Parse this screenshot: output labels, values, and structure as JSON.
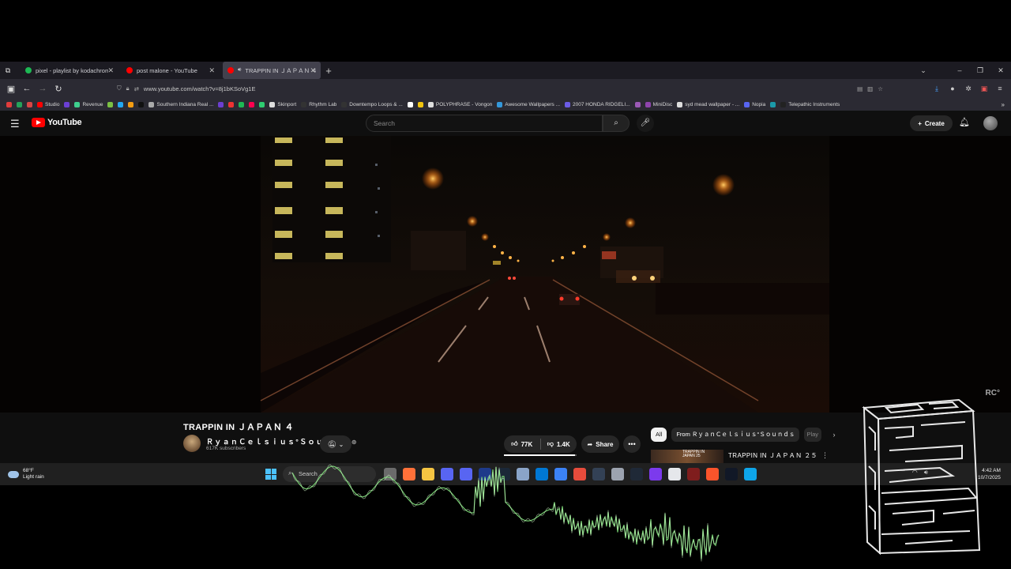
{
  "browser": {
    "tabs": [
      {
        "label": "pixel - playlist by kodachrome",
        "favicon_color": "#1db954",
        "active": false
      },
      {
        "label": "post malone - YouTube",
        "favicon_color": "#ff0000",
        "active": false
      },
      {
        "label": "TRAPPIN IN ＪＡＰＡＮ ４",
        "favicon_color": "#ff0000",
        "active": true
      }
    ],
    "new_tab_glyph": "+",
    "url": "www.youtube.com/watch?v=8j1bKSoVg1E",
    "bookmarks": [
      {
        "label": "",
        "color": "#e03c3c"
      },
      {
        "label": "",
        "color": "#25a35a"
      },
      {
        "label": "",
        "color": "#d94545"
      },
      {
        "label": "Studio",
        "color": "#ff0000"
      },
      {
        "label": "",
        "color": "#6b3fd4"
      },
      {
        "label": "Revenue",
        "color": "#3ecf8e"
      },
      {
        "label": "",
        "color": "#7bc043"
      },
      {
        "label": "",
        "color": "#22a7f0"
      },
      {
        "label": "",
        "color": "#f39c12"
      },
      {
        "label": "",
        "color": "#111"
      },
      {
        "label": "Southern Indiana Real ...",
        "color": "#aaaaaa"
      },
      {
        "label": "",
        "color": "#6c3fd0"
      },
      {
        "label": "",
        "color": "#e33"
      },
      {
        "label": "",
        "color": "#1db954"
      },
      {
        "label": "",
        "color": "#ff0050"
      },
      {
        "label": "",
        "color": "#2ecc71"
      },
      {
        "label": "Skinport",
        "color": "#dddddd"
      },
      {
        "label": "Rhythm Lab",
        "color": "#333"
      },
      {
        "label": "Downtempo Loops & ...",
        "color": "#333"
      },
      {
        "label": "",
        "color": "#ffffff"
      },
      {
        "label": "",
        "color": "#f1c40f"
      },
      {
        "label": "POLYPHRASE - Vongon",
        "color": "#dddddd"
      },
      {
        "label": "Awesome Wallpapers ...",
        "color": "#3498db"
      },
      {
        "label": "2007 HONDA RIDGELI...",
        "color": "#6c5ce7"
      },
      {
        "label": "",
        "color": "#9b59b6"
      },
      {
        "label": "MiniDisc",
        "color": "#8e44ad"
      },
      {
        "label": "syd mead wallpaper - ...",
        "color": "#dddddd"
      },
      {
        "label": "Nopia",
        "color": "#5865f2"
      },
      {
        "label": "",
        "color": "#1b9aaa"
      },
      {
        "label": "Telepathic Instruments",
        "color": "#222"
      }
    ]
  },
  "youtube": {
    "logo_text": "YouTube",
    "search_placeholder": "Search",
    "create_label": "Create",
    "video_title": "TRAPPIN IN ＪＡＰＡＮ ４",
    "channel_name": "ＲｙａｎＣｅｌｓｉｕｓ°Ｓｏｕｎｄｓ",
    "subscribers": "617K subscribers",
    "likes": "77K",
    "dislikes": "1.4K",
    "like_ratio": 0.98,
    "share_label": "Share",
    "chips": [
      "All",
      "From ＲｙａｎＣｅｌｓｉｕｓ°Ｓｏｕｎｄｓ",
      "Play"
    ],
    "rec_title": "TRAPPIN IN ＪＡＰＡＮ ２５",
    "rec_thumb_text": "TRAPPIN IN\nJAPAN 25",
    "watermark": "RC°",
    "accent": "#ff0000"
  },
  "taskbar": {
    "temp": "68°F",
    "weather": "Light rain",
    "search_placeholder": "Search",
    "time": "4:42 AM",
    "date": "10/7/2025",
    "apps": [
      "#6b6b6b",
      "#ff7139",
      "#f5c542",
      "#5865f2",
      "#5865f2",
      "#1e3a8a",
      "#1b2838",
      "#8aa4c8",
      "#0078d4",
      "#3b82f6",
      "#e74c3c",
      "#334155",
      "#9ca3af",
      "#1f2937",
      "#7c3aed",
      "#e5e7eb",
      "#7f1d1d",
      "#fb542b",
      "#111827",
      "#0ea5e9"
    ]
  }
}
